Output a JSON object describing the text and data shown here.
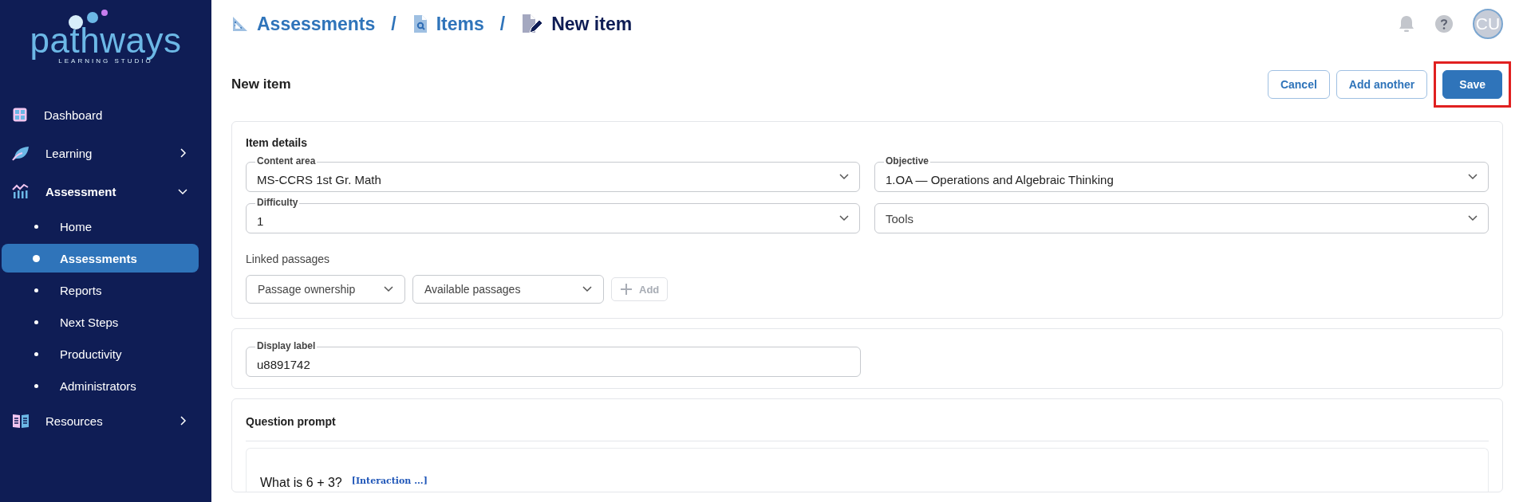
{
  "logo": {
    "name": "pathways",
    "tagline": "LEARNING STUDIO"
  },
  "sidebar": {
    "items": [
      {
        "label": "Dashboard",
        "has_children": false
      },
      {
        "label": "Learning",
        "expanded": false,
        "has_children": true
      },
      {
        "label": "Assessment",
        "expanded": true,
        "has_children": true,
        "children": [
          {
            "label": "Home",
            "selected": false
          },
          {
            "label": "Assessments",
            "selected": true
          },
          {
            "label": "Reports",
            "selected": false
          },
          {
            "label": "Next Steps",
            "selected": false
          },
          {
            "label": "Productivity",
            "selected": false
          },
          {
            "label": "Administrators",
            "selected": false
          }
        ]
      },
      {
        "label": "Resources",
        "expanded": false,
        "has_children": true
      }
    ]
  },
  "breadcrumb": [
    {
      "label": "Assessments",
      "current": false
    },
    {
      "label": "Items",
      "current": false
    },
    {
      "label": "New item",
      "current": true
    }
  ],
  "breadcrumb_separator": "/",
  "header": {
    "avatar": "CU"
  },
  "page_title": "New item",
  "buttons": [
    {
      "label": "Cancel",
      "kind": "outline",
      "highlighted": false
    },
    {
      "label": "Add another",
      "kind": "outline",
      "highlighted": false
    },
    {
      "label": "Save",
      "kind": "primary",
      "highlighted": true
    }
  ],
  "item_details": {
    "title": "Item details",
    "fields": [
      {
        "label": "Content area",
        "value": "MS-CCRS 1st Gr. Math"
      },
      {
        "label": "Objective",
        "value": "1.OA — Operations and Algebraic Thinking"
      },
      {
        "label": "Difficulty",
        "value": "1"
      },
      {
        "placeholder": "Tools"
      }
    ],
    "linked_passages": {
      "label": "Linked passages",
      "selects": [
        "Passage ownership",
        "Available passages"
      ],
      "add_button": {
        "label": "Add",
        "disabled": true
      }
    }
  },
  "display_label": {
    "label": "Display label",
    "value": "u8891742"
  },
  "question_prompt": {
    "title": "Question prompt",
    "text": "What is 6 + 3?",
    "interaction": "[Interaction ...]"
  }
}
